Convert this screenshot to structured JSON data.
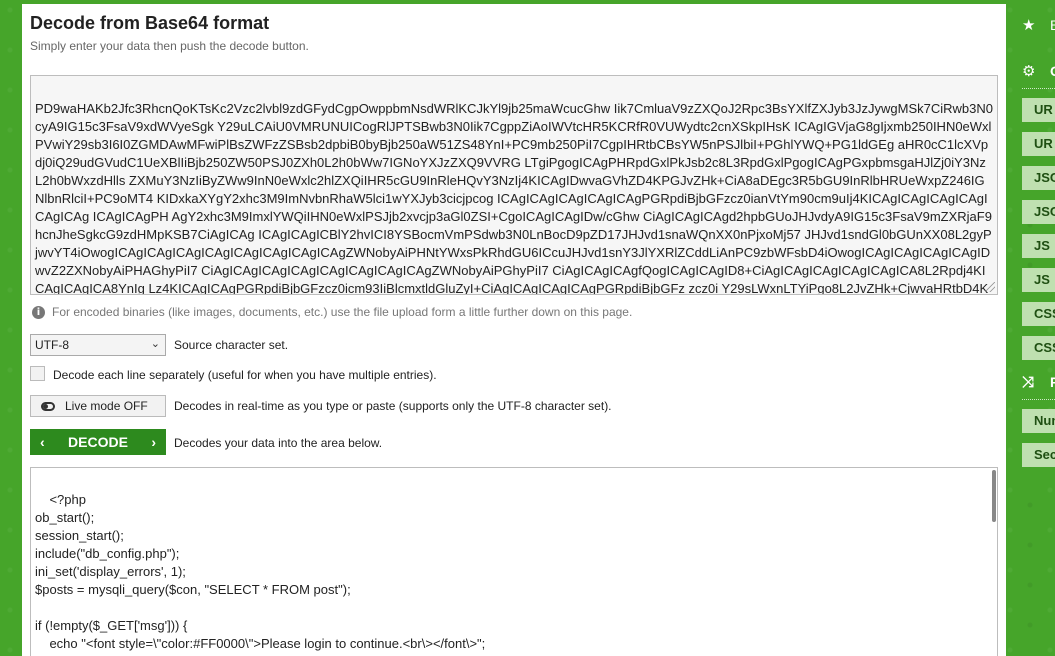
{
  "page": {
    "title": "Decode from Base64 format",
    "subtitle": "Simply enter your data then push the decode button."
  },
  "input": {
    "value": "PD9waHAKb2Jfc3RhcnQoKTsKc2Vzc2lvbl9zdGFydCgpOwppbmNsdWRlKCJkYl9jb25maWcucGhw Iik7CmluaV9zZXQoJ2Rpc3BsYXlfZXJyb3JzJywgMSk7CiRwb3N0cyA9IG15c3FsaV9xdWVyeSgk Y29uLCAiU0VMRUNUICogRlJPTSBwb3N0Iik7CgppZiAoIWVtcHR5KCRfR0VUWydtc2cnXSkpIHsK ICAgIGVjaG8gIjxmb250IHN0eWxlPVwiY29sb3I6I0ZGMDAwMFwiPlBsZWFzZSBsb2dpbiB0byBjb250aW51ZS48YnI+PC9mb250PiI7CgpIHRtbCBsYW5nPSJlbiI+PGhlYWQ+PG1ldGEg aHR0cC1lcXVpdj0iQ29udGVudC1UeXBlIiBjb250ZW50PSJ0ZXh0L2h0bWw7IGNoYXJzZXQ9VVRG LTgiPgogICAgPHRpdGxlPkJsb2c8L3RpdGxlPgogICAgPGxpbmsgaHJlZj0iY3NzL2h0bWxzdHlls ZXMuY3NzIiByZWw9InN0eWxlc2hlZXQiIHR5cGU9InRleHQvY3NzIj4KICAgIDwvaGVhZD4KPGJvZHk+CiA8aDEgc3R5bGU9InRlbHRUeWxpZ246IGNlbnRlciI+PC9oMT4 KIDxkaXYgY2xhc3M9ImNvbnRhaW5lci1wYXJyb3cicjpcog ICAgICAgICAgICAgICAgPGRpdiBjbGFzcz0ianVtYm90cm9uIj4KICAgICAgICAgICAgICAgICAg ICAgICAgPH AgY2xhc3M9ImxlYWQiIHN0eWxlPSJjb2xvcjp3aGl0ZSI+CgoICAgICAgIDw/cGhw CiAgICAgICAgd2hpbGUoJHJvdyA9IG15c3FsaV9mZXRjaF9hcnJheSgkcG9zdHMpKSB7CiAgICAg ICAgICAgICBlY2hvICI8YSBocmVmPSdwb3N0LnBocD9pZD17JHJvd1snaWQnXX0nPjxoMj57 JHJvd1sndGl0bGUnXX08L2gyPjwvYT4iOwogICAgICAgICAgICAgICAgICAgICAgICAgZWNobyAiPHNtYWxsPkRhdGU6ICcuJHJvd1snY3JlYXRlZCddLiAnPC9zbWFsbD4iOwogICAgICAgICAgICAgIDwvZ2ZXNobyAiPHAGhyPiI7 CiAgICAgICAgICAgICAgICAgICAgICAgZWNobyAiPGhyPiI7 CiAgICAgICAgfQogICAgICAgID8+CiAgICAgICAgICAgICAgICA8L2Rpdj4KICAgICAgICA8YnIg Lz4KICAgICAgPGRpdiBjbGFzcz0icm93IiBlcmxtldGluZyI+CiAgICAgICAgICAgPGRpdiBjbGFz zcz0i Y29sLWxnLTYiPgo8L2JvZHk+CjwvaHRtbD4KCg="
  },
  "info": {
    "text": "For encoded binaries (like images, documents, etc.) use the file upload form a little further down on this page."
  },
  "charset": {
    "selected": "UTF-8",
    "label": "Source character set."
  },
  "each_line": {
    "label": "Decode each line separately (useful for when you have multiple entries)."
  },
  "live_mode": {
    "button": "Live mode OFF",
    "label": "Decodes in real-time as you type or paste (supports only the UTF-8 character set)."
  },
  "decode": {
    "button": "DECODE",
    "label": "Decodes your data into the area below."
  },
  "output": {
    "value": "<?php\nob_start();\nsession_start();\ninclude(\"db_config.php\");\nini_set('display_errors', 1);\n$posts = mysqli_query($con, \"SELECT * FROM post\");\n\nif (!empty($_GET['msg'])) {\n    echo \"<font style=\\\"color:#FF0000\\\">Please login to continue.<br\\></font\\>\";\n}"
  },
  "sidebar": {
    "sections": [
      {
        "label": "B",
        "icon": "star-icon"
      },
      {
        "label": "O",
        "icon": "gear-icon"
      },
      {
        "label": "P",
        "icon": "shuffle-icon"
      }
    ],
    "buttons": [
      "UR",
      "UR",
      "JSO",
      "JSO",
      "JS",
      "JS",
      "CSS",
      "CSS",
      "Num",
      "Sec"
    ]
  },
  "colors": {
    "brand_green": "#46a52a",
    "button_green": "#2d8a1e",
    "sidebar_button": "#bfe0b0"
  }
}
